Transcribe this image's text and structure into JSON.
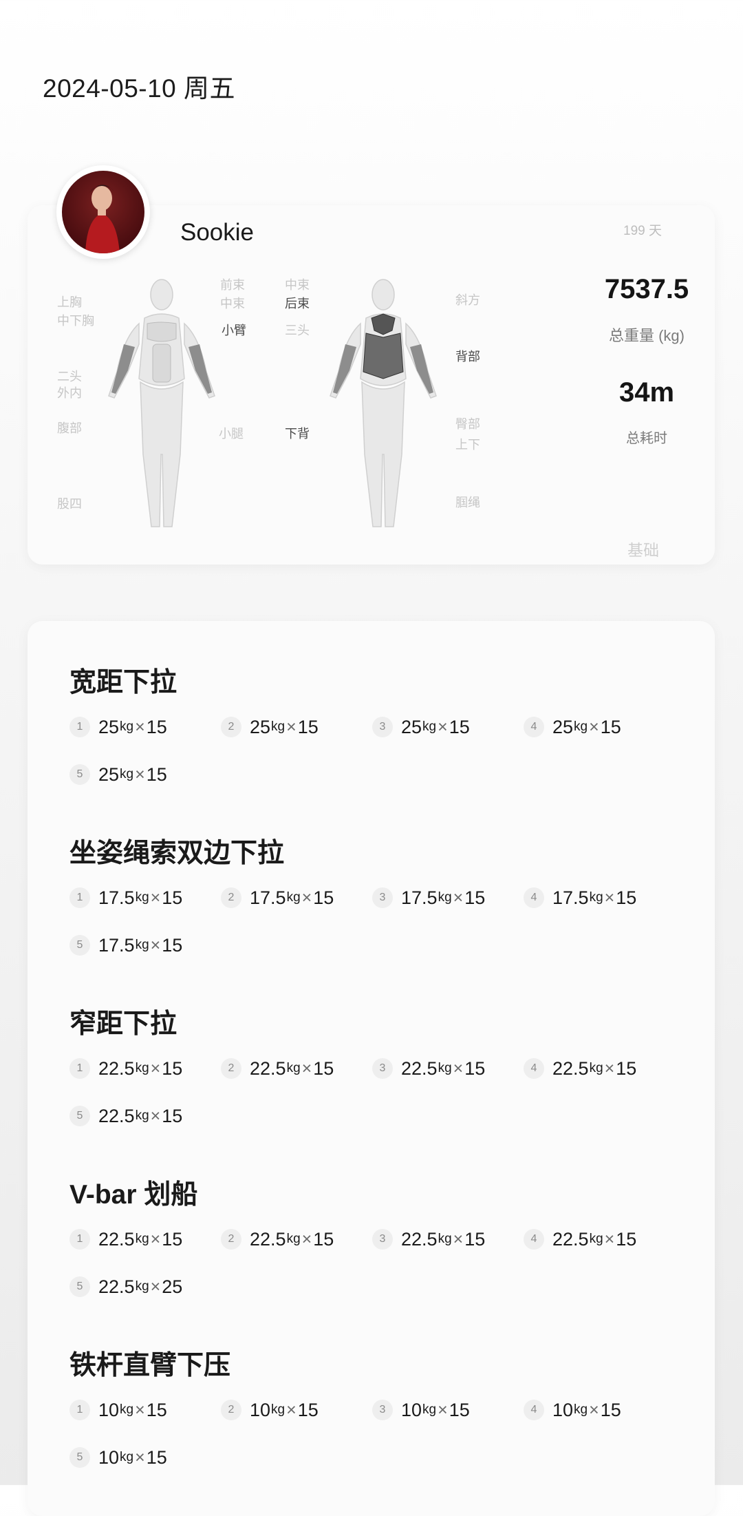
{
  "date": "2024-05-10 周五",
  "profile": {
    "name": "Sookie",
    "days": "199 天",
    "level": "基础"
  },
  "stats": {
    "total_weight": "7537.5",
    "total_weight_label": "总重量 (kg)",
    "total_time": "34m",
    "total_time_label": "总耗时"
  },
  "muscles_front": {
    "upper_chest": "上胸",
    "mid_lower_chest": "中下胸",
    "biceps": "二头",
    "forearm_outer": "外内",
    "abs": "腹部",
    "quads": "股四",
    "front_delt": "前束",
    "mid_delt": "中束",
    "forearm": "小臂",
    "calf": "小腿"
  },
  "muscles_back": {
    "mid_delt": "中束",
    "rear_delt": "后束",
    "triceps": "三头",
    "lower_back": "下背",
    "trapezius": "斜方",
    "back": "背部",
    "glutes": "臀部",
    "glutes_sub": "上下",
    "hamstrings": "腘绳"
  },
  "unit": "kg",
  "times_sign": "×",
  "exercises": [
    {
      "name": "宽距下拉",
      "sets": [
        {
          "n": "1",
          "w": "25",
          "r": "15"
        },
        {
          "n": "2",
          "w": "25",
          "r": "15"
        },
        {
          "n": "3",
          "w": "25",
          "r": "15"
        },
        {
          "n": "4",
          "w": "25",
          "r": "15"
        },
        {
          "n": "5",
          "w": "25",
          "r": "15"
        }
      ]
    },
    {
      "name": "坐姿绳索双边下拉",
      "sets": [
        {
          "n": "1",
          "w": "17.5",
          "r": "15"
        },
        {
          "n": "2",
          "w": "17.5",
          "r": "15"
        },
        {
          "n": "3",
          "w": "17.5",
          "r": "15"
        },
        {
          "n": "4",
          "w": "17.5",
          "r": "15"
        },
        {
          "n": "5",
          "w": "17.5",
          "r": "15"
        }
      ]
    },
    {
      "name": "窄距下拉",
      "sets": [
        {
          "n": "1",
          "w": "22.5",
          "r": "15"
        },
        {
          "n": "2",
          "w": "22.5",
          "r": "15"
        },
        {
          "n": "3",
          "w": "22.5",
          "r": "15"
        },
        {
          "n": "4",
          "w": "22.5",
          "r": "15"
        },
        {
          "n": "5",
          "w": "22.5",
          "r": "15"
        }
      ]
    },
    {
      "name": "V-bar 划船",
      "sets": [
        {
          "n": "1",
          "w": "22.5",
          "r": "15"
        },
        {
          "n": "2",
          "w": "22.5",
          "r": "15"
        },
        {
          "n": "3",
          "w": "22.5",
          "r": "15"
        },
        {
          "n": "4",
          "w": "22.5",
          "r": "15"
        },
        {
          "n": "5",
          "w": "22.5",
          "r": "25"
        }
      ]
    },
    {
      "name": "铁杆直臂下压",
      "sets": [
        {
          "n": "1",
          "w": "10",
          "r": "15"
        },
        {
          "n": "2",
          "w": "10",
          "r": "15"
        },
        {
          "n": "3",
          "w": "10",
          "r": "15"
        },
        {
          "n": "4",
          "w": "10",
          "r": "15"
        },
        {
          "n": "5",
          "w": "10",
          "r": "15"
        }
      ]
    }
  ]
}
